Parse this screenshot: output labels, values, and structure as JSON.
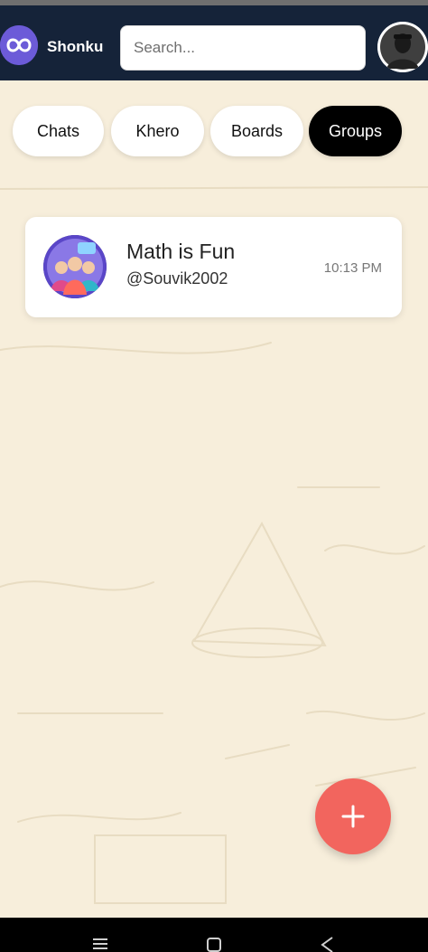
{
  "app": {
    "name": "Shonku",
    "logo_icon": "infinity-chat-logo-icon",
    "brand_color": "#6c5bd8"
  },
  "search": {
    "placeholder": "Search..."
  },
  "profile": {
    "avatar_icon": "user-avatar-icon"
  },
  "tabs": [
    {
      "label": "Chats",
      "active": false
    },
    {
      "label": "Khero",
      "active": false
    },
    {
      "label": "Boards",
      "active": false
    },
    {
      "label": "Groups",
      "active": true
    }
  ],
  "groups": [
    {
      "title": "Math is Fun",
      "handle": "@Souvik2002",
      "time": "10:13 PM",
      "avatar_icon": "group-avatar-icon"
    }
  ],
  "fab": {
    "icon": "plus-icon",
    "color": "#f2655e"
  },
  "nav": {
    "icons": [
      "menu-icon",
      "home-square-icon",
      "back-triangle-icon"
    ]
  },
  "colors": {
    "header": "#152339",
    "background": "#f7eedb",
    "active_tab": "#000000"
  }
}
